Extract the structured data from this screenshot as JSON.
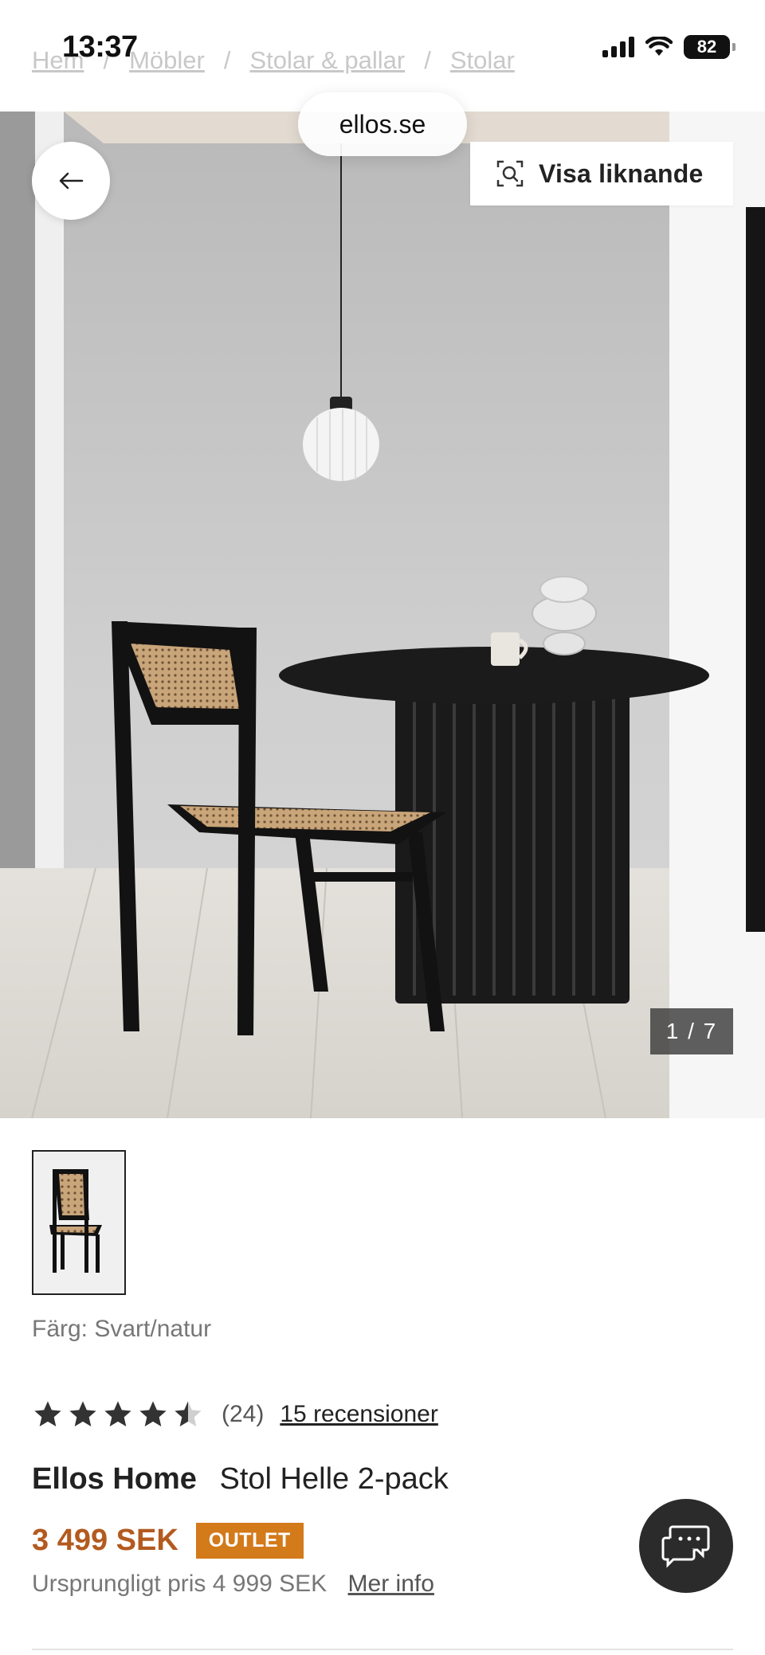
{
  "status_bar": {
    "time": "13:37",
    "battery": "82"
  },
  "breadcrumb": {
    "items": [
      "Hem",
      "Möbler",
      "Stolar & pallar",
      "Stolar"
    ],
    "separator": "/"
  },
  "browser": {
    "url_label": "ellos.se"
  },
  "gallery": {
    "similar_label": "Visa liknande",
    "counter": "1 / 7"
  },
  "product": {
    "color_label": "Färg: Svart/natur",
    "rating": 4.5,
    "rating_count": "(24)",
    "reviews_link": "15 recensioner",
    "brand": "Ellos Home",
    "name": "Stol Helle 2-pack",
    "price": "3 499 SEK",
    "badge": "OUTLET",
    "original_price": "Ursprungligt pris 4 999 SEK",
    "more_info": "Mer info"
  },
  "icons": {
    "back": "arrow-left-icon",
    "similar": "visual-search-icon",
    "chat": "chat-bubble-icon"
  },
  "colors": {
    "price": "#b35a1f",
    "badge": "#d37a1a",
    "chat_button": "#2b2b2b"
  }
}
